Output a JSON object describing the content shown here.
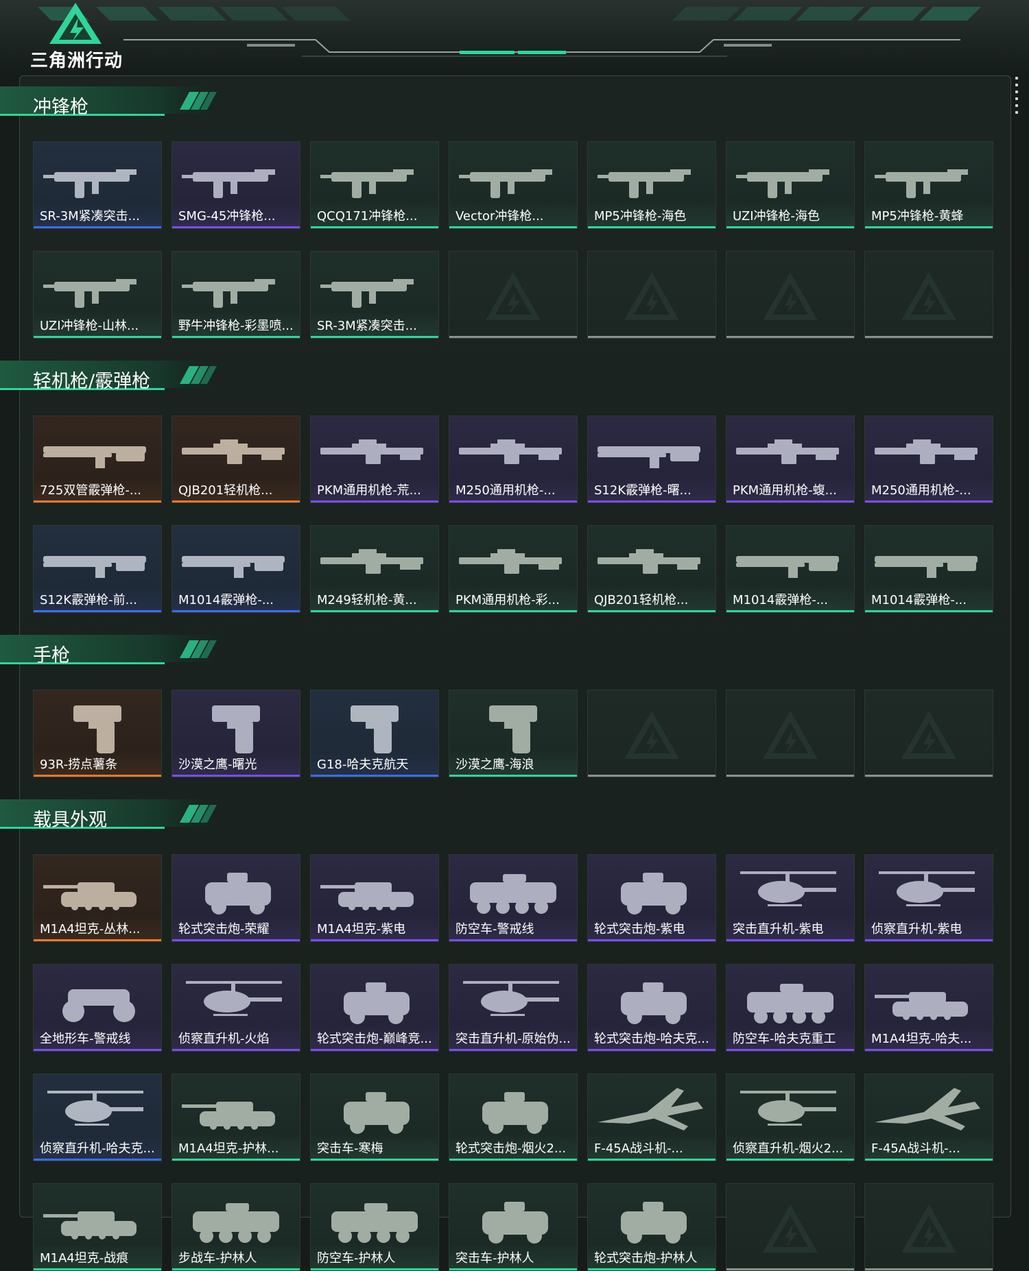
{
  "header": {
    "game_title": "三角洲行动"
  },
  "colors": {
    "accent": "#2fd59a",
    "rarity_blue": "#3b6cf0",
    "rarity_purple": "#7b4cf0",
    "rarity_green": "#2fd59a",
    "rarity_orange": "#f0782a",
    "rarity_empty": "#8a918e"
  },
  "sections": [
    {
      "title": "冲锋枪",
      "items": [
        {
          "label": "SR-3M紧凑突击...",
          "rarity": "blue",
          "icon": "smg-icon"
        },
        {
          "label": "SMG-45冲锋枪...",
          "rarity": "purple",
          "icon": "smg-icon"
        },
        {
          "label": "QCQ171冲锋枪...",
          "rarity": "green",
          "icon": "smg-icon"
        },
        {
          "label": "Vector冲锋枪...",
          "rarity": "green",
          "icon": "smg-icon"
        },
        {
          "label": "MP5冲锋枪-海色",
          "rarity": "green",
          "icon": "smg-icon"
        },
        {
          "label": "UZI冲锋枪-海色",
          "rarity": "green",
          "icon": "smg-icon"
        },
        {
          "label": "MP5冲锋枪-黄蜂",
          "rarity": "green",
          "icon": "smg-icon"
        },
        {
          "label": "UZI冲锋枪-山林...",
          "rarity": "green",
          "icon": "smg-icon"
        },
        {
          "label": "野牛冲锋枪-彩墨喷...",
          "rarity": "green",
          "icon": "smg-icon"
        },
        {
          "label": "SR-3M紧凑突击...",
          "rarity": "green",
          "icon": "smg-icon"
        },
        {
          "label": "",
          "rarity": "empty",
          "icon": "empty-slot-icon"
        },
        {
          "label": "",
          "rarity": "empty",
          "icon": "empty-slot-icon"
        },
        {
          "label": "",
          "rarity": "empty",
          "icon": "empty-slot-icon"
        },
        {
          "label": "",
          "rarity": "empty",
          "icon": "empty-slot-icon"
        }
      ]
    },
    {
      "title": "轻机枪/霰弹枪",
      "items": [
        {
          "label": "725双管霰弹枪-...",
          "rarity": "orange",
          "icon": "shotgun-icon"
        },
        {
          "label": "QJB201轻机枪...",
          "rarity": "orange",
          "icon": "lmg-icon"
        },
        {
          "label": "PKM通用机枪-荒...",
          "rarity": "purple",
          "icon": "lmg-icon"
        },
        {
          "label": "M250通用机枪-...",
          "rarity": "purple",
          "icon": "lmg-icon"
        },
        {
          "label": "S12K霰弹枪-曙...",
          "rarity": "purple",
          "icon": "shotgun-icon"
        },
        {
          "label": "PKM通用机枪-蝮...",
          "rarity": "purple",
          "icon": "lmg-icon"
        },
        {
          "label": "M250通用机枪-...",
          "rarity": "purple",
          "icon": "lmg-icon"
        },
        {
          "label": "S12K霰弹枪-前...",
          "rarity": "blue",
          "icon": "shotgun-icon"
        },
        {
          "label": "M1014霰弹枪-...",
          "rarity": "blue",
          "icon": "shotgun-icon"
        },
        {
          "label": "M249轻机枪-黄...",
          "rarity": "green",
          "icon": "lmg-icon"
        },
        {
          "label": "PKM通用机枪-彩...",
          "rarity": "green",
          "icon": "lmg-icon"
        },
        {
          "label": "QJB201轻机枪...",
          "rarity": "green",
          "icon": "lmg-icon"
        },
        {
          "label": "M1014霰弹枪-...",
          "rarity": "green",
          "icon": "shotgun-icon"
        },
        {
          "label": "M1014霰弹枪-...",
          "rarity": "green",
          "icon": "shotgun-icon"
        }
      ]
    },
    {
      "title": "手枪",
      "items": [
        {
          "label": "93R-捞点薯条",
          "rarity": "orange",
          "icon": "pistol-icon"
        },
        {
          "label": "沙漠之鹰-曙光",
          "rarity": "purple",
          "icon": "pistol-icon"
        },
        {
          "label": "G18-哈夫克航天",
          "rarity": "blue",
          "icon": "pistol-icon"
        },
        {
          "label": "沙漠之鹰-海浪",
          "rarity": "green",
          "icon": "pistol-icon"
        },
        {
          "label": "",
          "rarity": "empty",
          "icon": "empty-slot-icon"
        },
        {
          "label": "",
          "rarity": "empty",
          "icon": "empty-slot-icon"
        },
        {
          "label": "",
          "rarity": "empty",
          "icon": "empty-slot-icon"
        }
      ]
    },
    {
      "title": "载具外观",
      "items": [
        {
          "label": "M1A4坦克-丛林...",
          "rarity": "orange",
          "icon": "tank-icon"
        },
        {
          "label": "轮式突击炮-荣耀",
          "rarity": "purple",
          "icon": "armored-car-icon"
        },
        {
          "label": "M1A4坦克-紫电",
          "rarity": "purple",
          "icon": "tank-icon"
        },
        {
          "label": "防空车-警戒线",
          "rarity": "purple",
          "icon": "apc-icon"
        },
        {
          "label": "轮式突击炮-紫电",
          "rarity": "purple",
          "icon": "armored-car-icon"
        },
        {
          "label": "突击直升机-紫电",
          "rarity": "purple",
          "icon": "helicopter-icon"
        },
        {
          "label": "侦察直升机-紫电",
          "rarity": "purple",
          "icon": "helicopter-icon"
        },
        {
          "label": "全地形车-警戒线",
          "rarity": "purple",
          "icon": "atv-icon"
        },
        {
          "label": "侦察直升机-火焰",
          "rarity": "purple",
          "icon": "helicopter-icon"
        },
        {
          "label": "轮式突击炮-巅峰竞...",
          "rarity": "purple",
          "icon": "armored-car-icon"
        },
        {
          "label": "突击直升机-原始伪...",
          "rarity": "purple",
          "icon": "helicopter-icon"
        },
        {
          "label": "轮式突击炮-哈夫克...",
          "rarity": "purple",
          "icon": "armored-car-icon"
        },
        {
          "label": "防空车-哈夫克重工",
          "rarity": "purple",
          "icon": "apc-icon"
        },
        {
          "label": "M1A4坦克-哈夫...",
          "rarity": "purple",
          "icon": "tank-icon"
        },
        {
          "label": "侦察直升机-哈夫克...",
          "rarity": "blue",
          "icon": "helicopter-icon"
        },
        {
          "label": "M1A4坦克-护林...",
          "rarity": "green",
          "icon": "tank-icon"
        },
        {
          "label": "突击车-寒梅",
          "rarity": "green",
          "icon": "armored-car-icon"
        },
        {
          "label": "轮式突击炮-烟火2...",
          "rarity": "green",
          "icon": "armored-car-icon"
        },
        {
          "label": "F-45A战斗机-...",
          "rarity": "green",
          "icon": "jet-icon"
        },
        {
          "label": "侦察直升机-烟火2...",
          "rarity": "green",
          "icon": "helicopter-icon"
        },
        {
          "label": "F-45A战斗机-...",
          "rarity": "green",
          "icon": "jet-icon"
        },
        {
          "label": "M1A4坦克-战痕",
          "rarity": "green",
          "icon": "tank-icon"
        },
        {
          "label": "步战车-护林人",
          "rarity": "green",
          "icon": "apc-icon"
        },
        {
          "label": "防空车-护林人",
          "rarity": "green",
          "icon": "apc-icon"
        },
        {
          "label": "突击车-护林人",
          "rarity": "green",
          "icon": "armored-car-icon"
        },
        {
          "label": "轮式突击炮-护林人",
          "rarity": "green",
          "icon": "armored-car-icon"
        },
        {
          "label": "",
          "rarity": "empty",
          "icon": "empty-slot-icon"
        },
        {
          "label": "",
          "rarity": "empty",
          "icon": "empty-slot-icon"
        }
      ]
    }
  ]
}
